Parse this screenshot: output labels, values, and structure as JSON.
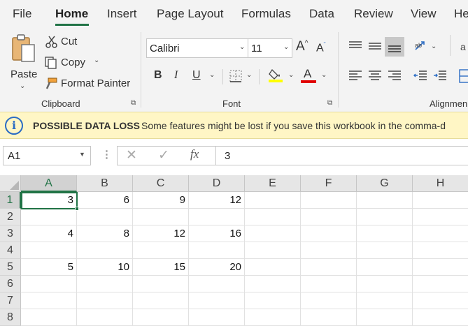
{
  "menu": {
    "tabs": [
      "File",
      "Home",
      "Insert",
      "Page Layout",
      "Formulas",
      "Data",
      "Review",
      "View",
      "He"
    ],
    "active": "Home"
  },
  "ribbon": {
    "clipboard": {
      "paste": "Paste",
      "cut": "Cut",
      "copy": "Copy",
      "format_painter": "Format Painter",
      "group_label": "Clipboard"
    },
    "font": {
      "font_name": "Calibri",
      "font_size": "11",
      "bold": "B",
      "italic": "I",
      "underline": "U",
      "font_color_glyph": "A",
      "group_label": "Font",
      "highlight_color": "#ffff00",
      "font_color": "#e00000"
    },
    "alignment": {
      "group_label": "Alignmen"
    },
    "cropped_glyph": "a"
  },
  "notice": {
    "title": "POSSIBLE DATA LOSS",
    "message": "Some features might be lost if you save this workbook in the comma-d",
    "info_glyph": "i"
  },
  "formula_bar": {
    "name_box": "A1",
    "fx": "fx",
    "value": "3"
  },
  "grid": {
    "columns": [
      "A",
      "B",
      "C",
      "D",
      "E",
      "F",
      "G",
      "H"
    ],
    "rows": [
      "1",
      "2",
      "3",
      "4",
      "5",
      "6",
      "7",
      "8"
    ],
    "selected_cell": "A1",
    "cells": [
      [
        "3",
        "6",
        "9",
        "12",
        "",
        "",
        "",
        ""
      ],
      [
        "",
        "",
        "",
        "",
        "",
        "",
        "",
        ""
      ],
      [
        "4",
        "8",
        "12",
        "16",
        "",
        "",
        "",
        ""
      ],
      [
        "",
        "",
        "",
        "",
        "",
        "",
        "",
        ""
      ],
      [
        "5",
        "10",
        "15",
        "20",
        "",
        "",
        "",
        ""
      ],
      [
        "",
        "",
        "",
        "",
        "",
        "",
        "",
        ""
      ],
      [
        "",
        "",
        "",
        "",
        "",
        "",
        "",
        ""
      ],
      [
        "",
        "",
        "",
        "",
        "",
        "",
        "",
        ""
      ]
    ]
  },
  "colors": {
    "accent": "#217346",
    "notice_bg": "#fff6c5",
    "info_blue": "#2b6cc4"
  }
}
